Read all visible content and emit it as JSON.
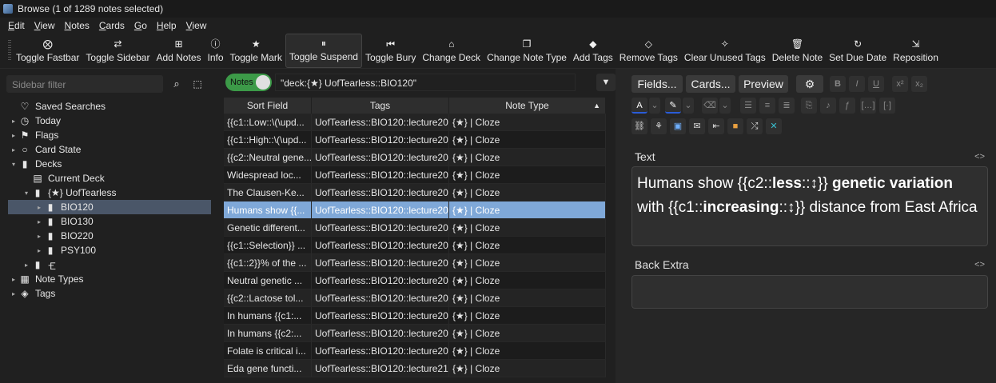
{
  "window": {
    "title": "Browse (1 of 1289 notes selected)"
  },
  "menubar": [
    "Edit",
    "View",
    "Notes",
    "Cards",
    "Go",
    "Help",
    "View"
  ],
  "toolbar": [
    {
      "label": "Toggle Fastbar",
      "icon": "⨂"
    },
    {
      "label": "Toggle Sidebar",
      "icon": "⇄"
    },
    {
      "label": "Add Notes",
      "icon": "⊞"
    },
    {
      "label": "Info",
      "icon": "ⓘ"
    },
    {
      "label": "Toggle Mark",
      "icon": "★"
    },
    {
      "label": "Toggle Suspend",
      "icon": "⏸"
    },
    {
      "label": "Toggle Bury",
      "icon": "⏮"
    },
    {
      "label": "Change Deck",
      "icon": "⌂"
    },
    {
      "label": "Change Note Type",
      "icon": "❐"
    },
    {
      "label": "Add Tags",
      "icon": "◆"
    },
    {
      "label": "Remove Tags",
      "icon": "◇"
    },
    {
      "label": "Clear Unused Tags",
      "icon": "✧"
    },
    {
      "label": "Delete Note",
      "icon": "🗑"
    },
    {
      "label": "Set Due Date",
      "icon": "↻"
    },
    {
      "label": "Reposition",
      "icon": "⇲"
    }
  ],
  "sidebar": {
    "filter_placeholder": "Sidebar filter",
    "tree": [
      {
        "label": "Saved Searches",
        "icon": "♡",
        "indent": 0,
        "arrow": ""
      },
      {
        "label": "Today",
        "icon": "◷",
        "indent": 0,
        "arrow": "▸"
      },
      {
        "label": "Flags",
        "icon": "⚑",
        "indent": 0,
        "arrow": "▸"
      },
      {
        "label": "Card State",
        "icon": "○",
        "indent": 0,
        "arrow": "▸"
      },
      {
        "label": "Decks",
        "icon": "▮",
        "indent": 0,
        "arrow": "▾"
      },
      {
        "label": "Current Deck",
        "icon": "▤",
        "indent": 1,
        "arrow": ""
      },
      {
        "label": "{★} UofTearless",
        "icon": "▮",
        "indent": 1,
        "arrow": "▾"
      },
      {
        "label": "BIO120",
        "icon": "▮",
        "indent": 2,
        "arrow": "▸",
        "selected": true
      },
      {
        "label": "BIO130",
        "icon": "▮",
        "indent": 2,
        "arrow": "▸"
      },
      {
        "label": "BIO220",
        "icon": "▮",
        "indent": 2,
        "arrow": "▸"
      },
      {
        "label": "PSY100",
        "icon": "▮",
        "indent": 2,
        "arrow": "▸"
      },
      {
        "label": "🝗",
        "icon": "▮",
        "indent": 1,
        "arrow": "▸"
      },
      {
        "label": "Note Types",
        "icon": "▦",
        "indent": 0,
        "arrow": "▸"
      },
      {
        "label": "Tags",
        "icon": "◈",
        "indent": 0,
        "arrow": "▸"
      }
    ]
  },
  "search": {
    "toggle_label": "Notes",
    "query": "\"deck:{★} UofTearless::BIO120\""
  },
  "table": {
    "headers": [
      "Sort Field",
      "Tags",
      "Note Type"
    ],
    "rows": [
      [
        "{{c1::Low::\\(\\upd...",
        "UofTearless::BIO120::lecture20",
        "{★} | Cloze"
      ],
      [
        "{{c1::High::\\(\\upd...",
        "UofTearless::BIO120::lecture20",
        "{★} | Cloze"
      ],
      [
        "{{c2::Neutral gene...",
        "UofTearless::BIO120::lecture20",
        "{★} | Cloze"
      ],
      [
        "Widespread loc...",
        "UofTearless::BIO120::lecture20",
        "{★} | Cloze"
      ],
      [
        "The Clausen-Ke...",
        "UofTearless::BIO120::lecture20",
        "{★} | Cloze"
      ],
      [
        "Humans show {{...",
        "UofTearless::BIO120::lecture20",
        "{★} | Cloze"
      ],
      [
        "Genetic different...",
        "UofTearless::BIO120::lecture20",
        "{★} | Cloze"
      ],
      [
        "{{c1::Selection}} ...",
        "UofTearless::BIO120::lecture20",
        "{★} | Cloze"
      ],
      [
        "{{c1::2}}% of the ...",
        "UofTearless::BIO120::lecture20",
        "{★} | Cloze"
      ],
      [
        "Neutral genetic ...",
        "UofTearless::BIO120::lecture20",
        "{★} | Cloze"
      ],
      [
        "{{c2::Lactose tol...",
        "UofTearless::BIO120::lecture20",
        "{★} | Cloze"
      ],
      [
        "In humans {{c1:...",
        "UofTearless::BIO120::lecture20",
        "{★} | Cloze"
      ],
      [
        "In humans {{c2:...",
        "UofTearless::BIO120::lecture20",
        "{★} | Cloze"
      ],
      [
        "Folate is critical i...",
        "UofTearless::BIO120::lecture20",
        "{★} | Cloze"
      ],
      [
        "Eda gene functi...",
        "UofTearless::BIO120::lecture21",
        "{★} | Cloze"
      ]
    ],
    "selected_index": 5
  },
  "editor": {
    "fields_btn": "Fields...",
    "cards_btn": "Cards...",
    "preview_btn": "Preview",
    "field1_name": "Text",
    "field2_name": "Back Extra",
    "text_parts": [
      "Humans show {{c2::",
      "less",
      "::↕}} ",
      "genetic variation",
      " with {{c1::",
      "increasing",
      "::↕}} distance from East Africa"
    ]
  }
}
